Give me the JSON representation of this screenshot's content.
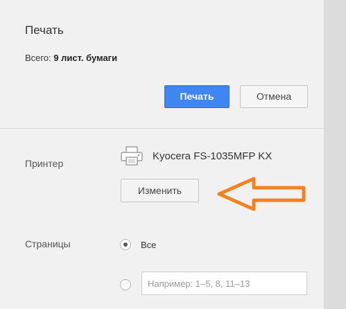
{
  "dialog": {
    "title": "Печать",
    "summary_prefix": "Всего: ",
    "summary_value": "9 лист. бумаги"
  },
  "actions": {
    "print_label": "Печать",
    "cancel_label": "Отмена"
  },
  "printer": {
    "label": "Принтер",
    "name": "Kyocera FS-1035MFP KX",
    "change_label": "Изменить",
    "icon": "printer-icon"
  },
  "pages": {
    "label": "Страницы",
    "all_label": "Все",
    "all_selected": true,
    "custom_placeholder": "Например: 1–5, 8, 11–13",
    "custom_value": ""
  },
  "annotation": {
    "arrow_color": "#f5821f",
    "arrow_direction": "left"
  },
  "colors": {
    "accent": "#3f86f2",
    "panel_bg": "#f1f1f1"
  }
}
